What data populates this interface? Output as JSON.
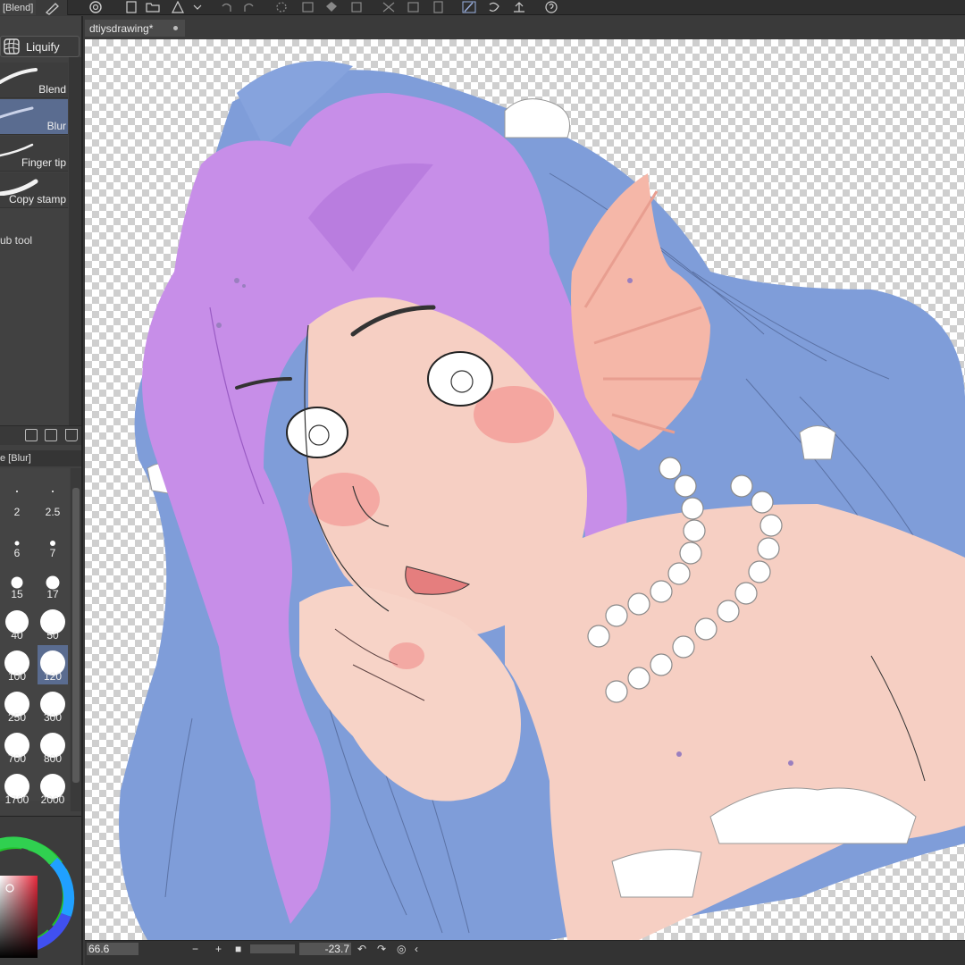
{
  "toolbar": {
    "subtool_tab": "[Blend]"
  },
  "subtool": {
    "group_button": "Liquify",
    "brushes": [
      {
        "label": "Blend",
        "selected": false
      },
      {
        "label": "Blur",
        "selected": true
      },
      {
        "label": "Finger tip",
        "selected": false
      },
      {
        "label": "Copy stamp",
        "selected": false
      }
    ],
    "scrub_label": "ub tool"
  },
  "brush_size": {
    "header": "e [Blur]",
    "sizes": [
      "2",
      "2.5",
      "6",
      "7",
      "15",
      "17",
      "40",
      "50",
      "100",
      "120",
      "250",
      "300",
      "700",
      "800",
      "1700",
      "2000"
    ],
    "selected": "120"
  },
  "document": {
    "tab_title": "dtiysdrawing*"
  },
  "status": {
    "zoom": "66.6",
    "rotation": "-23.7"
  },
  "colors": {
    "accent": "#5a6c90",
    "hair_blue": "#7f9dd9",
    "hair_purple": "#c78ee8",
    "skin": "#f6cfc3"
  }
}
